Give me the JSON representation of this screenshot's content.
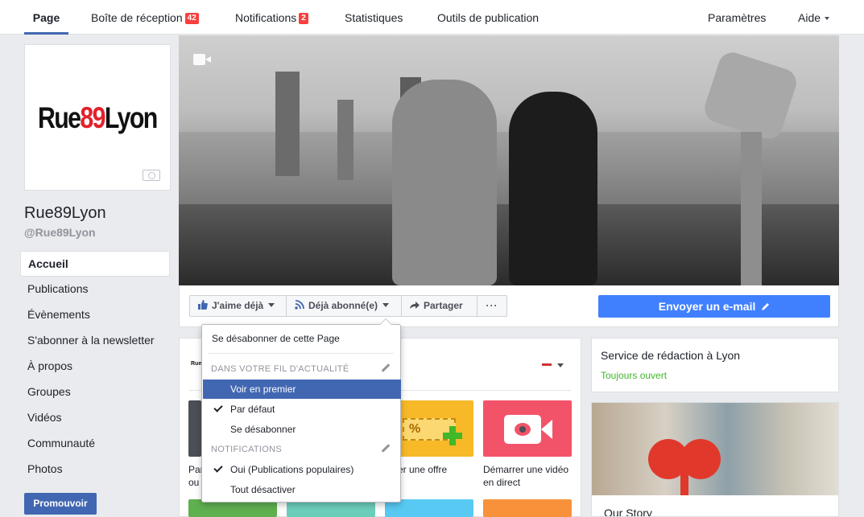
{
  "topnav": {
    "tabs": [
      {
        "label": "Page",
        "active": true
      },
      {
        "label": "Boîte de réception",
        "badge": "42"
      },
      {
        "label": "Notifications",
        "badge": "2"
      },
      {
        "label": "Statistiques"
      },
      {
        "label": "Outils de publication"
      }
    ],
    "settings": "Paramètres",
    "help": "Aide"
  },
  "profile": {
    "logo_left": "Rue",
    "logo_num": "89",
    "logo_right": "Lyon",
    "name": "Rue89Lyon",
    "handle": "@Rue89Lyon"
  },
  "sidenav": {
    "items": [
      "Accueil",
      "Publications",
      "Évènements",
      "S'abonner à la newsletter",
      "À propos",
      "Groupes",
      "Vidéos",
      "Communauté",
      "Photos"
    ],
    "promote": "Promouvoir"
  },
  "actions": {
    "like": "J'aime déjà",
    "subscribed": "Déjà abonné(e)",
    "share": "Partager",
    "more": "···",
    "email": "Envoyer un e-mail"
  },
  "dropdown": {
    "unsubscribe_page": "Se désabonner de cette Page",
    "feed_header": "DANS VOTRE FIL D'ACTUALITÉ",
    "see_first": "Voir en premier",
    "default": "Par défaut",
    "unfollow": "Se désabonner",
    "notif_header": "NOTIFICATIONS",
    "notif_on": "Oui (Publications populaires)",
    "notif_off": "Tout désactiver"
  },
  "feed": {
    "mini_logo": "Rue",
    "tile_dark_label_1": "Par",
    "tile_dark_label_2": "ou",
    "tile_offer_label": "er une offre",
    "tile_video_label_1": "Démarrer une vidéo",
    "tile_video_label_2": "en direct"
  },
  "right": {
    "service_title": "Service de rédaction à Lyon",
    "service_status": "Toujours ouvert",
    "story_title": "Our Story"
  },
  "colors": {
    "fb_blue": "#4267b2",
    "email_blue": "#4080ff",
    "badge_red": "#fa3e3e",
    "open_green": "#42b72a",
    "logo_red": "#e3202a"
  }
}
